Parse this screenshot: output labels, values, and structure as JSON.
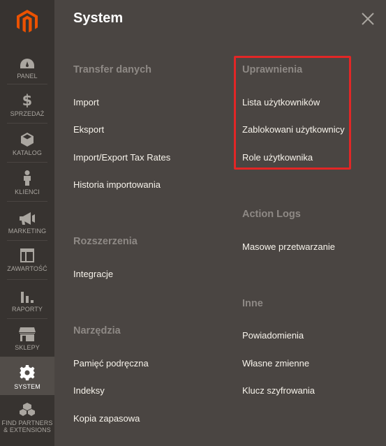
{
  "sidebar": {
    "items": [
      {
        "label": "PANEL",
        "icon": "dashboard-icon"
      },
      {
        "label": "SPRZEDAŻ",
        "icon": "dollar-icon"
      },
      {
        "label": "KATALOG",
        "icon": "cube-icon"
      },
      {
        "label": "KLIENCI",
        "icon": "person-icon"
      },
      {
        "label": "MARKETING",
        "icon": "megaphone-icon"
      },
      {
        "label": "ZAWARTOŚĆ",
        "icon": "layout-icon"
      },
      {
        "label": "RAPORTY",
        "icon": "bar-chart-icon"
      },
      {
        "label": "SKLEPY",
        "icon": "store-icon"
      },
      {
        "label": "SYSTEM",
        "icon": "gear-icon"
      },
      {
        "label_line1": "FIND PARTNERS",
        "label_line2": "& EXTENSIONS",
        "icon": "boxes-icon"
      }
    ]
  },
  "panel": {
    "title": "System",
    "left_column": {
      "transfer": {
        "title": "Transfer danych",
        "links": [
          "Import",
          "Eksport",
          "Import/Export Tax Rates",
          "Historia importowania"
        ]
      },
      "extensions": {
        "title": "Rozszerzenia",
        "links": [
          "Integracje"
        ]
      },
      "tools": {
        "title": "Narzędzia",
        "links": [
          "Pamięć podręczna",
          "Indeksy",
          "Kopia zapasowa"
        ]
      }
    },
    "right_column": {
      "permissions": {
        "title": "Uprawnienia",
        "links": [
          "Lista użytkowników",
          "Zablokowani użytkownicy",
          "Role użytkownika"
        ]
      },
      "action_logs": {
        "title": "Action Logs",
        "links": [
          "Masowe przetwarzanie"
        ]
      },
      "other": {
        "title": "Inne",
        "links": [
          "Powiadomienia",
          "Własne zmienne",
          "Klucz szyfrowania"
        ]
      }
    }
  },
  "colors": {
    "sidebar_bg": "#373330",
    "panel_bg": "#4a4542",
    "active_bg": "#524d49",
    "logo": "#eb5202",
    "highlight": "#e22626"
  }
}
